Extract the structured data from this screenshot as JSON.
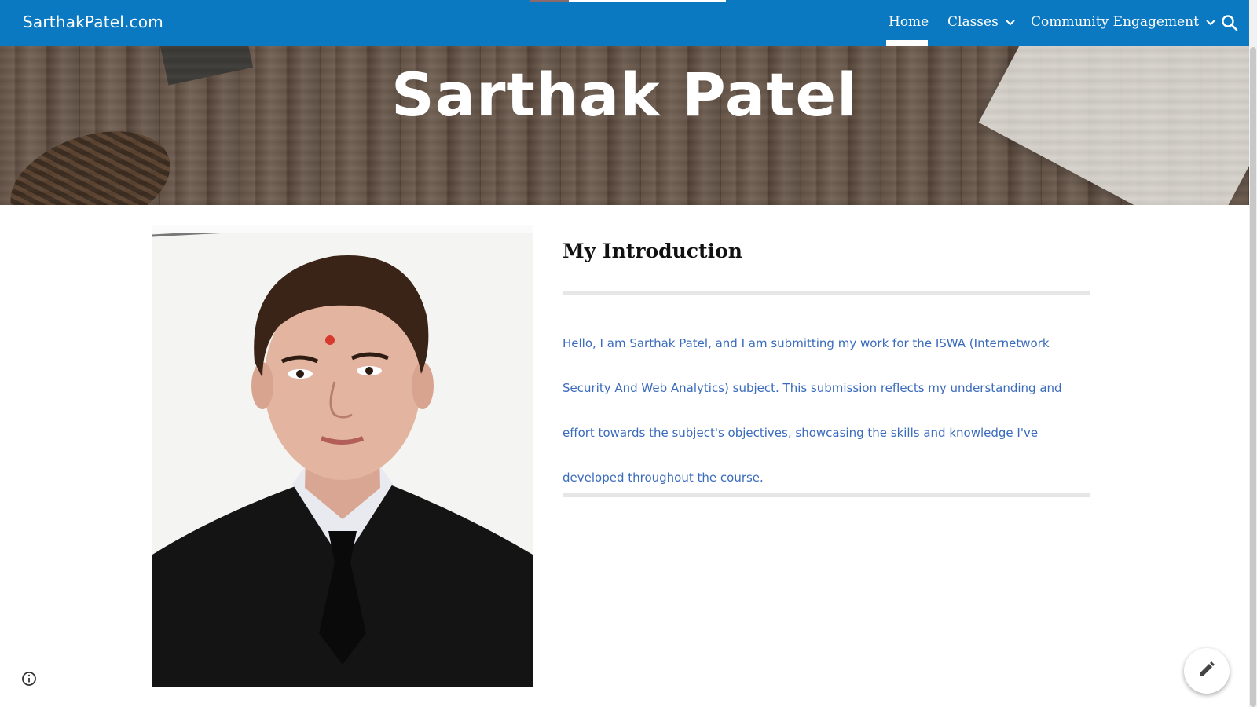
{
  "header": {
    "site_title": "SarthakPatel.com",
    "nav": [
      {
        "label": "Home",
        "active": true,
        "has_dropdown": false
      },
      {
        "label": "Classes",
        "active": false,
        "has_dropdown": true
      },
      {
        "label": "Community Engagement",
        "active": false,
        "has_dropdown": true
      }
    ],
    "search_icon": "search-icon",
    "accent_color": "#0b79c1"
  },
  "hero": {
    "title": "Sarthak Patel"
  },
  "main": {
    "heading": "My Introduction",
    "paragraph": "Hello, I am Sarthak Patel, and I am submitting my work for the ISWA (Internetwork Security And Web Analytics) subject. This submission reflects my understanding and effort towards the subject's objectives, showcasing the skills and knowledge I've developed throughout the course.",
    "text_color": "#3a6bbd"
  },
  "floating": {
    "info_icon": "info-icon",
    "edit_icon": "pencil-icon"
  }
}
